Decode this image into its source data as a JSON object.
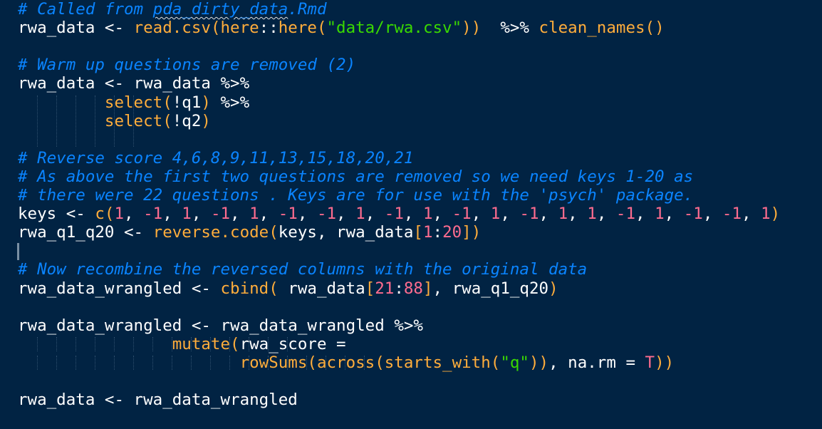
{
  "editor": {
    "lines": [
      {
        "id": "line-1",
        "tokens": [
          {
            "t": "# Called from ",
            "c": "cmt"
          },
          {
            "t": "pda_dirty_data",
            "c": "cmt squiggle"
          },
          {
            "t": ".Rmd",
            "c": "cmt"
          }
        ]
      },
      {
        "id": "line-2",
        "tokens": [
          {
            "t": "rwa_data ",
            "c": "sym"
          },
          {
            "t": "<-",
            "c": "op"
          },
          {
            "t": " ",
            "c": "sym"
          },
          {
            "t": "read.csv",
            "c": "fn"
          },
          {
            "t": "(",
            "c": "paren"
          },
          {
            "t": "here",
            "c": "fn"
          },
          {
            "t": "::",
            "c": "op"
          },
          {
            "t": "here",
            "c": "fn"
          },
          {
            "t": "(",
            "c": "paren"
          },
          {
            "t": "\"data/rwa.csv\"",
            "c": "str"
          },
          {
            "t": "))",
            "c": "paren"
          },
          {
            "t": "  ",
            "c": "sym"
          },
          {
            "t": "%>%",
            "c": "op"
          },
          {
            "t": " ",
            "c": "sym"
          },
          {
            "t": "clean_names",
            "c": "fn"
          },
          {
            "t": "()",
            "c": "paren"
          }
        ]
      },
      {
        "id": "line-3",
        "tokens": []
      },
      {
        "id": "line-4",
        "tokens": [
          {
            "t": "# Warm up questions are removed (2)",
            "c": "cmt"
          }
        ]
      },
      {
        "id": "line-5",
        "tokens": [
          {
            "t": "rwa_data ",
            "c": "sym"
          },
          {
            "t": "<-",
            "c": "op"
          },
          {
            "t": " rwa_data ",
            "c": "sym"
          },
          {
            "t": "%>%",
            "c": "op"
          }
        ]
      },
      {
        "id": "line-6",
        "tokens": [
          {
            "t": "         ",
            "c": "sym"
          },
          {
            "t": "select",
            "c": "fn"
          },
          {
            "t": "(",
            "c": "paren"
          },
          {
            "t": "!q1",
            "c": "sym"
          },
          {
            "t": ")",
            "c": "paren"
          },
          {
            "t": " ",
            "c": "sym"
          },
          {
            "t": "%>%",
            "c": "op"
          }
        ]
      },
      {
        "id": "line-7",
        "tokens": [
          {
            "t": "         ",
            "c": "sym"
          },
          {
            "t": "select",
            "c": "fn"
          },
          {
            "t": "(",
            "c": "paren"
          },
          {
            "t": "!q2",
            "c": "sym"
          },
          {
            "t": ")",
            "c": "paren"
          }
        ]
      },
      {
        "id": "line-8",
        "tokens": []
      },
      {
        "id": "line-9",
        "tokens": [
          {
            "t": "# Reverse score 4,6,8,9,11,13,15,18,20,21",
            "c": "cmt"
          }
        ]
      },
      {
        "id": "line-10",
        "tokens": [
          {
            "t": "# As above the first two questions are removed so we need keys 1-20 as",
            "c": "cmt"
          }
        ]
      },
      {
        "id": "line-11",
        "tokens": [
          {
            "t": "# there were 22 questions . Keys are for use with the 'psych' package.",
            "c": "cmt"
          }
        ]
      },
      {
        "id": "line-12",
        "tokens": [
          {
            "t": "keys ",
            "c": "sym"
          },
          {
            "t": "<-",
            "c": "op"
          },
          {
            "t": " ",
            "c": "sym"
          },
          {
            "t": "c",
            "c": "fn"
          },
          {
            "t": "(",
            "c": "paren"
          },
          {
            "t": "1",
            "c": "num"
          },
          {
            "t": ", ",
            "c": "sym"
          },
          {
            "t": "-1",
            "c": "num"
          },
          {
            "t": ", ",
            "c": "sym"
          },
          {
            "t": "1",
            "c": "num"
          },
          {
            "t": ", ",
            "c": "sym"
          },
          {
            "t": "-1",
            "c": "num"
          },
          {
            "t": ", ",
            "c": "sym"
          },
          {
            "t": "1",
            "c": "num"
          },
          {
            "t": ", ",
            "c": "sym"
          },
          {
            "t": "-1",
            "c": "num"
          },
          {
            "t": ", ",
            "c": "sym"
          },
          {
            "t": "-1",
            "c": "num"
          },
          {
            "t": ", ",
            "c": "sym"
          },
          {
            "t": "1",
            "c": "num"
          },
          {
            "t": ", ",
            "c": "sym"
          },
          {
            "t": "-1",
            "c": "num"
          },
          {
            "t": ", ",
            "c": "sym"
          },
          {
            "t": "1",
            "c": "num"
          },
          {
            "t": ", ",
            "c": "sym"
          },
          {
            "t": "-1",
            "c": "num"
          },
          {
            "t": ", ",
            "c": "sym"
          },
          {
            "t": "1",
            "c": "num"
          },
          {
            "t": ", ",
            "c": "sym"
          },
          {
            "t": "-1",
            "c": "num"
          },
          {
            "t": ", ",
            "c": "sym"
          },
          {
            "t": "1",
            "c": "num"
          },
          {
            "t": ", ",
            "c": "sym"
          },
          {
            "t": "1",
            "c": "num"
          },
          {
            "t": ", ",
            "c": "sym"
          },
          {
            "t": "-1",
            "c": "num"
          },
          {
            "t": ", ",
            "c": "sym"
          },
          {
            "t": "1",
            "c": "num"
          },
          {
            "t": ", ",
            "c": "sym"
          },
          {
            "t": "-1",
            "c": "num"
          },
          {
            "t": ", ",
            "c": "sym"
          },
          {
            "t": "-1",
            "c": "num"
          },
          {
            "t": ", ",
            "c": "sym"
          },
          {
            "t": "1",
            "c": "num"
          },
          {
            "t": ")",
            "c": "paren"
          }
        ]
      },
      {
        "id": "line-13",
        "tokens": [
          {
            "t": "rwa_q1_q20 ",
            "c": "sym"
          },
          {
            "t": "<-",
            "c": "op"
          },
          {
            "t": " ",
            "c": "sym"
          },
          {
            "t": "reverse.code",
            "c": "fn"
          },
          {
            "t": "(",
            "c": "paren"
          },
          {
            "t": "keys, rwa_data",
            "c": "sym"
          },
          {
            "t": "[",
            "c": "paren"
          },
          {
            "t": "1",
            "c": "num"
          },
          {
            "t": ":",
            "c": "op"
          },
          {
            "t": "20",
            "c": "num"
          },
          {
            "t": "])",
            "c": "paren"
          }
        ]
      },
      {
        "id": "line-14",
        "tokens": []
      },
      {
        "id": "line-15",
        "tokens": [
          {
            "t": "# Now recombine the reversed columns with the original data",
            "c": "cmt"
          }
        ]
      },
      {
        "id": "line-16",
        "tokens": [
          {
            "t": "rwa_data_wrangled ",
            "c": "sym"
          },
          {
            "t": "<-",
            "c": "op"
          },
          {
            "t": " ",
            "c": "sym"
          },
          {
            "t": "cbind",
            "c": "fn"
          },
          {
            "t": "(",
            "c": "paren"
          },
          {
            "t": " rwa_data",
            "c": "sym"
          },
          {
            "t": "[",
            "c": "paren"
          },
          {
            "t": "21",
            "c": "num"
          },
          {
            "t": ":",
            "c": "op"
          },
          {
            "t": "88",
            "c": "num"
          },
          {
            "t": "]",
            "c": "paren"
          },
          {
            "t": ", rwa_q1_q20",
            "c": "sym"
          },
          {
            "t": ")",
            "c": "paren"
          }
        ]
      },
      {
        "id": "line-17",
        "tokens": []
      },
      {
        "id": "line-18",
        "tokens": [
          {
            "t": "rwa_data_wrangled ",
            "c": "sym"
          },
          {
            "t": "<-",
            "c": "op"
          },
          {
            "t": " rwa_data_wrangled ",
            "c": "sym"
          },
          {
            "t": "%>%",
            "c": "op"
          }
        ]
      },
      {
        "id": "line-19",
        "tokens": [
          {
            "t": "                ",
            "c": "sym"
          },
          {
            "t": "mutate",
            "c": "fn"
          },
          {
            "t": "(",
            "c": "paren"
          },
          {
            "t": "rwa_score ",
            "c": "sym"
          },
          {
            "t": "=",
            "c": "op"
          }
        ]
      },
      {
        "id": "line-20",
        "tokens": [
          {
            "t": "                       ",
            "c": "sym"
          },
          {
            "t": "rowSums",
            "c": "fn"
          },
          {
            "t": "(",
            "c": "paren"
          },
          {
            "t": "across",
            "c": "fn"
          },
          {
            "t": "(",
            "c": "paren"
          },
          {
            "t": "starts_with",
            "c": "fn"
          },
          {
            "t": "(",
            "c": "paren"
          },
          {
            "t": "\"q\"",
            "c": "str"
          },
          {
            "t": "))",
            "c": "paren"
          },
          {
            "t": ", na.rm ",
            "c": "sym"
          },
          {
            "t": "=",
            "c": "op"
          },
          {
            "t": " ",
            "c": "sym"
          },
          {
            "t": "T",
            "c": "num"
          },
          {
            "t": "))",
            "c": "paren"
          }
        ]
      },
      {
        "id": "line-21",
        "tokens": []
      },
      {
        "id": "line-22",
        "tokens": [
          {
            "t": "rwa_data ",
            "c": "sym"
          },
          {
            "t": "<-",
            "c": "op"
          },
          {
            "t": " rwa_data_wrangled",
            "c": "sym"
          }
        ]
      }
    ]
  }
}
